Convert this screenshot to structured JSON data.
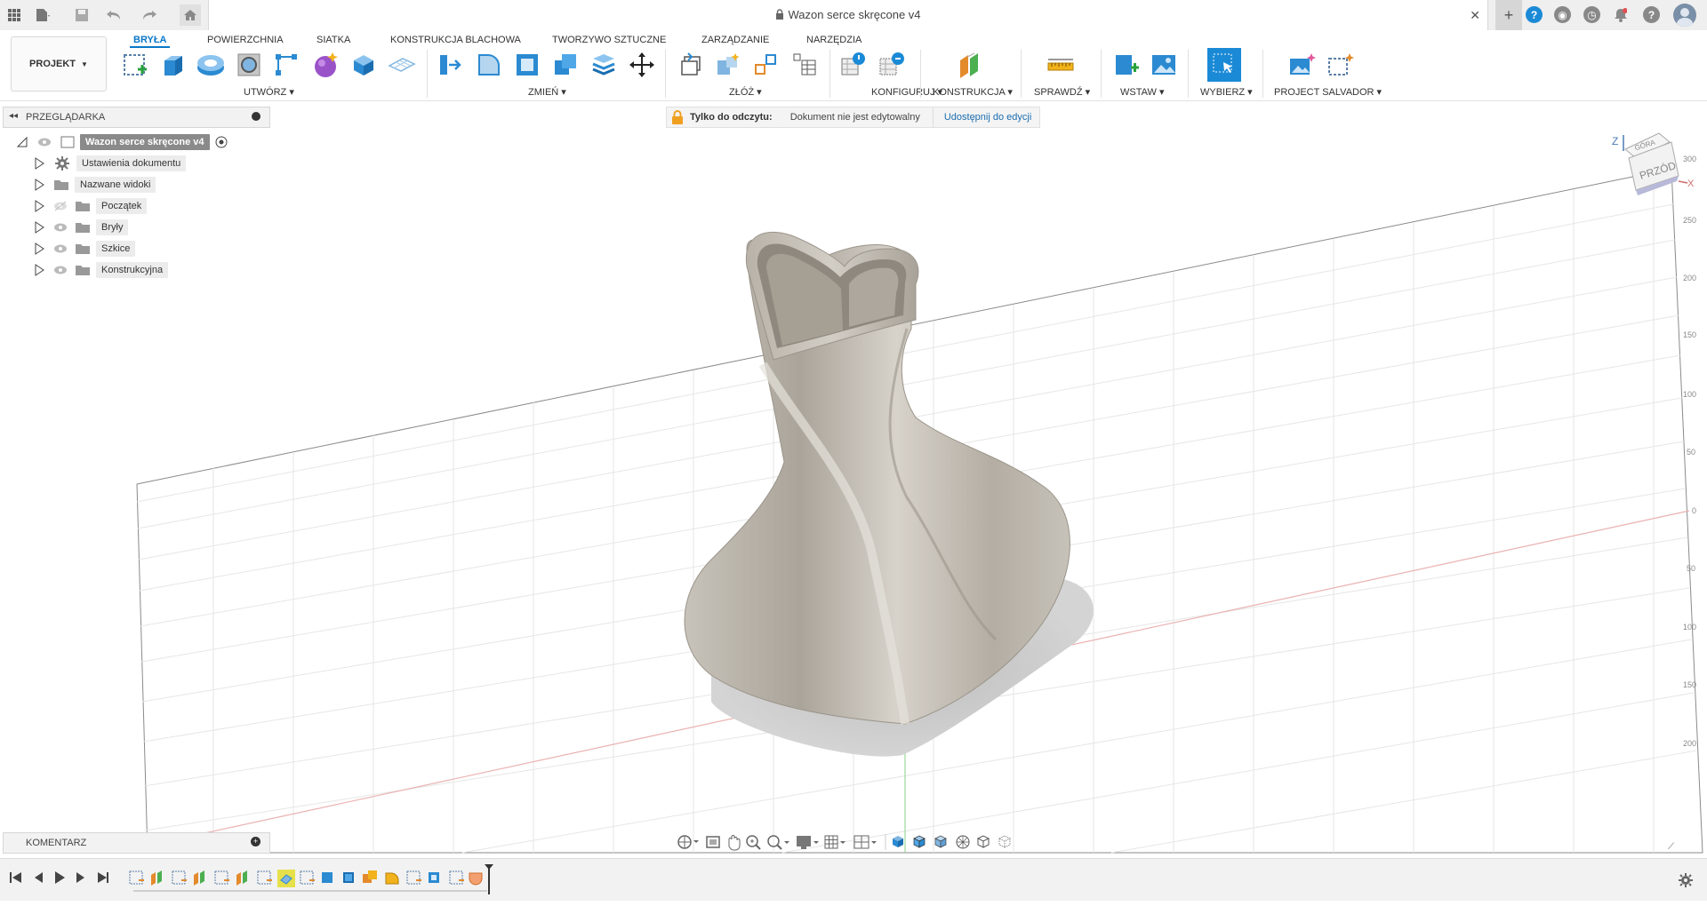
{
  "titlebar": {
    "document_title": "Wazon serce skręcone v4",
    "icons": [
      "grid-icon",
      "file-icon",
      "save-icon",
      "undo-icon",
      "redo-icon",
      "home-icon",
      "close-tab-icon",
      "new-tab-icon",
      "help-icon",
      "extensions-icon",
      "clock-icon",
      "notifications-icon",
      "question-icon",
      "avatar"
    ]
  },
  "toolbar": {
    "project_label": "PROJEKT",
    "tabs": [
      "BRYŁA",
      "POWIERZCHNIA",
      "SIATKA",
      "KONSTRUKCJA BLACHOWA",
      "TWORZYWO SZTUCZNE",
      "ZARZĄDZANIE",
      "NARZĘDZIA"
    ],
    "active_tab": "BRYŁA",
    "groups": [
      "UTWÓRZ",
      "ZMIEŃ",
      "ZŁÓŻ",
      "KONFIGURUJ",
      "KONSTRUKCJA",
      "SPRAWDŹ",
      "WSTAW",
      "WYBIERZ",
      "PROJECT SALVADOR"
    ]
  },
  "browser": {
    "title": "PRZEGLĄDARKA",
    "root": "Wazon serce skręcone v4",
    "items": [
      "Ustawienia dokumentu",
      "Nazwane widoki",
      "Początek",
      "Bryły",
      "Szkice",
      "Konstrukcyjna"
    ]
  },
  "readonly": {
    "label": "Tylko do odczytu:",
    "message": "Dokument nie jest edytowalny",
    "share_link": "Udostępnij do edycji"
  },
  "viewcube": {
    "front": "PRZÓD",
    "top": "GÓRA",
    "axis_z": "Z",
    "axis_x": "X",
    "ruler_ticks": [
      "300",
      "250",
      "200",
      "150",
      "100",
      "50",
      "0",
      "50",
      "100",
      "150",
      "200"
    ]
  },
  "comments": {
    "title": "KOMENTARZ"
  },
  "colors": {
    "accent": "#0a77c7",
    "model": "#b9b3a8",
    "grid": "#e3e3e3",
    "axis_red": "#e7a3a3",
    "axis_green": "#8fd38f",
    "lock": "#f0a020"
  }
}
